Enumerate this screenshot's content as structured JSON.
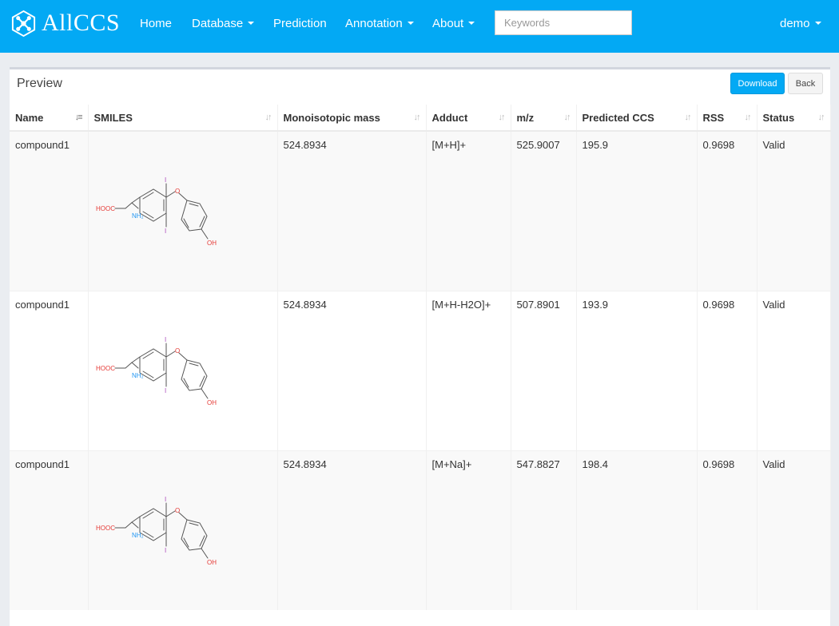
{
  "brand": {
    "name": "AllCCS",
    "logo_icon": "network-hex-logo-icon"
  },
  "nav": {
    "items": [
      {
        "label": "Home",
        "dropdown": false
      },
      {
        "label": "Database",
        "dropdown": true
      },
      {
        "label": "Prediction",
        "dropdown": false
      },
      {
        "label": "Annotation",
        "dropdown": true
      },
      {
        "label": "About",
        "dropdown": true
      }
    ],
    "search_placeholder": "Keywords",
    "user": "demo"
  },
  "panel": {
    "title": "Preview",
    "download_label": "Download",
    "back_label": "Back"
  },
  "table": {
    "headers": [
      "Name",
      "SMILES",
      "Monoisotopic mass",
      "Adduct",
      "m/z",
      "Predicted CCS",
      "RSS",
      "Status"
    ],
    "rows": [
      {
        "name": "compound1",
        "mass": "524.8934",
        "adduct": "[M+H]+",
        "mz": "525.9007",
        "ccs": "195.9",
        "rss": "0.9698",
        "status": "Valid"
      },
      {
        "name": "compound1",
        "mass": "524.8934",
        "adduct": "[M+H-H2O]+",
        "mz": "507.8901",
        "ccs": "193.9",
        "rss": "0.9698",
        "status": "Valid"
      },
      {
        "name": "compound1",
        "mass": "524.8934",
        "adduct": "[M+Na]+",
        "mz": "547.8827",
        "ccs": "198.4",
        "rss": "0.9698",
        "status": "Valid"
      }
    ],
    "structure_labels": {
      "hooc": "HOOC",
      "nh2": "NH₂",
      "iodine": "I",
      "oxygen": "O",
      "oh": "OH"
    }
  },
  "colors": {
    "navbar": "#03a9f4",
    "oxygen": "#e53935",
    "nitrogen": "#2196f3",
    "iodine": "#ab47bc",
    "bond": "#555555"
  }
}
